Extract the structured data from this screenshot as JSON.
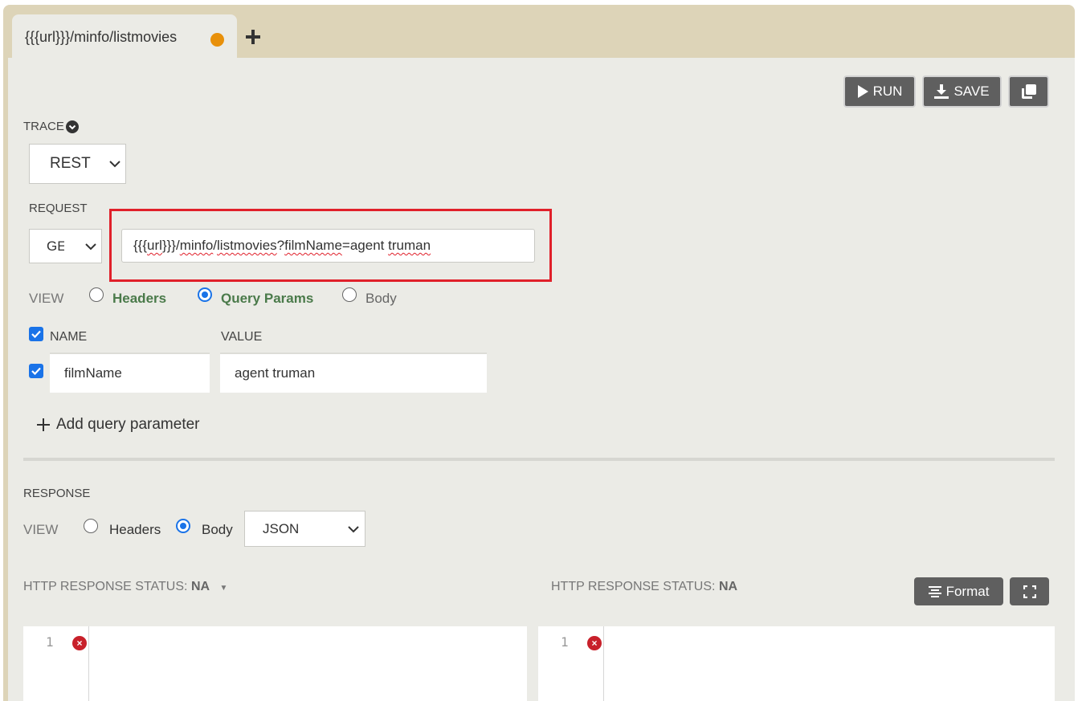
{
  "tabs": {
    "active_title": "{{{url}}}/minfo/listmovies",
    "add_tab_icon": "plus-icon",
    "unsaved_dot_color": "#e8900a"
  },
  "toolbar": {
    "run_label": "RUN",
    "save_label": "SAVE",
    "copy_icon": "copy-icon"
  },
  "trace": {
    "label": "TRACE",
    "protocol": "REST"
  },
  "request": {
    "label": "REQUEST",
    "method": "GET",
    "url_parts": [
      "{{{",
      "url",
      "}}}/",
      "minfo",
      "/",
      "listmovies",
      "?",
      "filmName",
      "=agent ",
      "truman"
    ],
    "view_label": "VIEW",
    "view_options": [
      "Headers",
      "Query Params",
      "Body"
    ],
    "view_selected": "Query Params",
    "params_headers": {
      "name": "NAME",
      "value": "VALUE"
    },
    "params": [
      {
        "enabled": true,
        "name": "filmName",
        "value": "agent truman"
      }
    ],
    "add_param_label": "Add query parameter"
  },
  "response": {
    "label": "RESPONSE",
    "view_label": "VIEW",
    "view_options": [
      "Headers",
      "Body"
    ],
    "view_selected": "Body",
    "format": "JSON",
    "status_left_label": "HTTP RESPONSE STATUS:",
    "status_left_value": "NA",
    "status_right_label": "HTTP RESPONSE STATUS:",
    "status_right_value": "NA",
    "format_button": "Format",
    "expand_icon": "expand-icon",
    "left_editor_line": "1",
    "right_editor_line": "1"
  },
  "colors": {
    "frame": "#ddd4b8",
    "panel": "#ebebe6",
    "button": "#5f5f5f",
    "highlight": "#e0202a",
    "accent": "#1a73e8",
    "active_view": "#4a7a4a"
  }
}
